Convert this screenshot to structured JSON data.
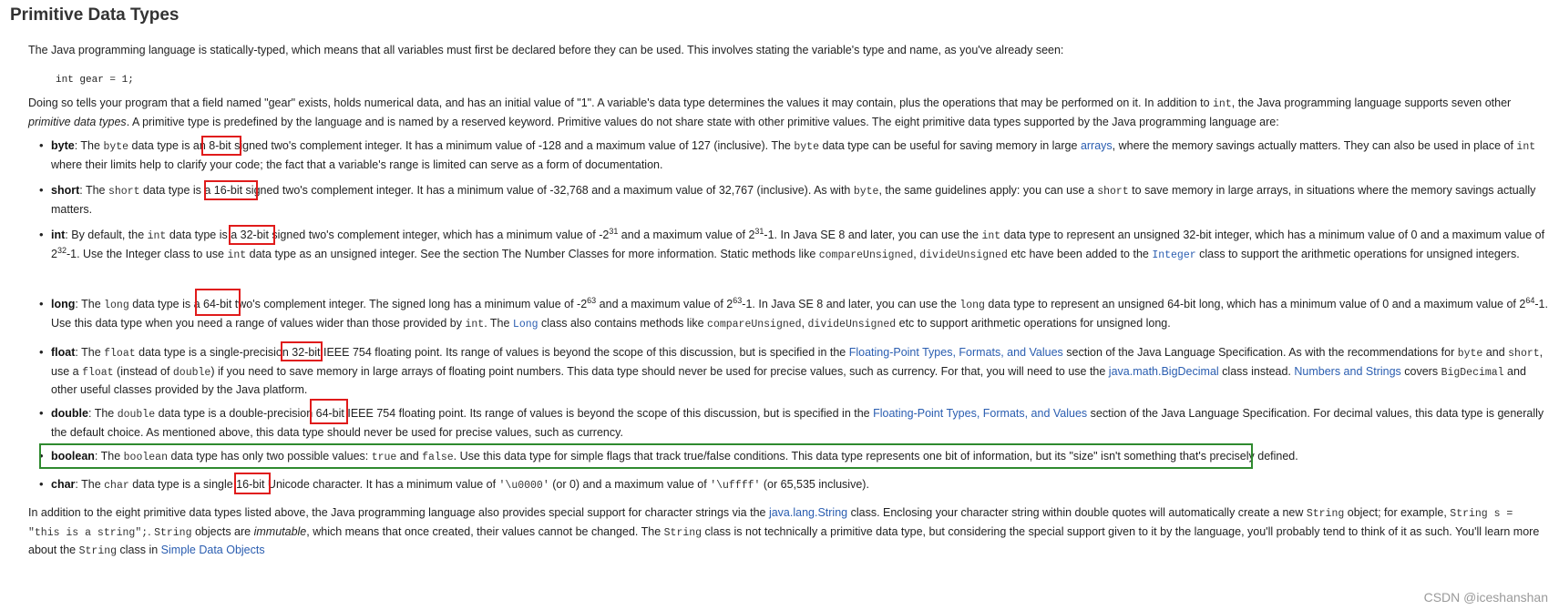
{
  "title": "Primitive Data Types",
  "intro": {
    "p1": "The Java programming language is statically-typed, which means that all variables must first be declared before they can be used. This involves stating the variable's type and name, as you've already seen:",
    "code": "int gear = 1;",
    "p2a": "Doing so tells your program that a field named \"gear\" exists, holds numerical data, and has an initial value of \"1\". A variable's data type determines the values it may contain, plus the operations that may be performed on it. In addition to ",
    "p2_int": "int",
    "p2b": ", the Java programming language supports seven other ",
    "p2_em": "primitive data types",
    "p2c": ". A primitive type is predefined by the language and is named by a reserved keyword. Primitive values do not share state with other primitive values. The eight primitive data types supported by the Java programming language are:"
  },
  "items": {
    "byte": {
      "term": "byte",
      "t1": ": The ",
      "c1": "byte",
      "t2": " data type is an 8-bit signed two's complement integer. It has a minimum value of -128 and a maximum value of 127 (inclusive). The ",
      "c2": "byte",
      "t3": " data type can be useful for saving memory in large ",
      "link1": "arrays",
      "t4": ", where the memory savings actually matters. They can also be used in place of ",
      "c3": "int",
      "t5": " where their limits help to clarify your code; the fact that a variable's range is limited can serve as a form of documentation."
    },
    "short": {
      "term": "short",
      "t1": ": The ",
      "c1": "short",
      "t2": " data type is a 16-bit signed two's complement integer. It has a minimum value of -32,768 and a maximum value of 32,767 (inclusive). As with ",
      "c2": "byte",
      "t3": ", the same guidelines apply: you can use a ",
      "c3": "short",
      "t4": " to save memory in large arrays, in situations where the memory savings actually matters."
    },
    "int": {
      "term": "int",
      "t1": ": By default, the ",
      "c1": "int",
      "t2": " data type is a 32-bit signed two's complement integer, which has a minimum value of -2",
      "s1": "31",
      "t3": " and a maximum value of 2",
      "s2": "31",
      "t4": "-1. In Java SE 8 and later, you can use the ",
      "c2": "int",
      "t5": " data type to represent an unsigned 32-bit integer, which has a minimum value of 0 and a maximum value of 2",
      "s3": "32",
      "t6": "-1. Use the Integer class to use ",
      "c3": "int",
      "t7": " data type as an unsigned integer. See the section The Number Classes for more information. Static methods like ",
      "c4": "compareUnsigned",
      "t8": ", ",
      "c5": "divideUnsigned",
      "t9": " etc have been added to the ",
      "link1": "Integer",
      "t10": " class to support the arithmetic operations for unsigned integers."
    },
    "long": {
      "term": "long",
      "t1": ": The ",
      "c1": "long",
      "t2": " data type is a 64-bit two's complement integer. The signed long has a minimum value of -2",
      "s1": "63",
      "t3": " and a maximum value of 2",
      "s2": "63",
      "t4": "-1. In Java SE 8 and later, you can use the ",
      "c2": "long",
      "t5": " data type to represent an unsigned 64-bit long, which has a minimum value of 0 and a maximum value of 2",
      "s3": "64",
      "t6": "-1. Use this data type when you need a range of values wider than those provided by ",
      "c3": "int",
      "t7": ". The ",
      "link1": "Long",
      "t8": " class also contains methods like ",
      "c4": "compareUnsigned",
      "t9": ", ",
      "c5": "divideUnsigned",
      "t10": " etc to support arithmetic operations for unsigned long."
    },
    "float": {
      "term": "float",
      "t1": ": The ",
      "c1": "float",
      "t2": " data type is a single-precision 32-bit IEEE 754 floating point. Its range of values is beyond the scope of this discussion, but is specified in the ",
      "link1": "Floating-Point Types, Formats, and Values",
      "t3": " section of the Java Language Specification. As with the recommendations for ",
      "c2": "byte",
      "t4": " and ",
      "c3": "short",
      "t5": ", use a ",
      "c4": "float",
      "t6": " (instead of ",
      "c5": "double",
      "t7": ") if you need to save memory in large arrays of floating point numbers. This data type should never be used for precise values, such as currency. For that, you will need to use the ",
      "link2": "java.math.BigDecimal",
      "t8": " class instead. ",
      "link3": "Numbers and Strings",
      "t9": " covers ",
      "c6": "BigDecimal",
      "t10": " and other useful classes provided by the Java platform."
    },
    "double": {
      "term": "double",
      "t1": ": The ",
      "c1": "double",
      "t2": " data type is a double-precision 64-bit IEEE 754 floating point. Its range of values is beyond the scope of this discussion, but is specified in the ",
      "link1": "Floating-Point Types, Formats, and Values",
      "t3": " section of the Java Language Specification. For decimal values, this data type is generally the default choice. As mentioned above, this data type should never be used for precise values, such as currency."
    },
    "boolean": {
      "term": "boolean",
      "t1": ": The ",
      "c1": "boolean",
      "t2": " data type has only two possible values: ",
      "c2": "true",
      "t3": " and ",
      "c3": "false",
      "t4": ". Use this data type for simple flags that track true/false conditions. This data type represents one bit of information, but its \"size\" isn't something that's precisely defined."
    },
    "char": {
      "term": "char",
      "t1": ": The ",
      "c1": "char",
      "t2": " data type is a single 16-bit Unicode character. It has a minimum value of ",
      "c2": "'\\u0000'",
      "t3": " (or 0) and a maximum value of ",
      "c3": "'\\uffff'",
      "t4": " (or 65,535 inclusive)."
    }
  },
  "outro": {
    "t1": "In addition to the eight primitive data types listed above, the Java programming language also provides special support for character strings via the ",
    "link1": "java.lang.String",
    "t2": " class. Enclosing your character string within double quotes will automatically create a new ",
    "c1": "String",
    "t3": " object; for example, ",
    "c2": "String s = \"this is a string\";",
    "t4": ". ",
    "c3": "String",
    "t5": " objects are ",
    "em1": "immutable",
    "t6": ", which means that once created, their values cannot be changed. The ",
    "c4": "String",
    "t7": " class is not technically a primitive data type, but considering the special support given to it by the language, you'll probably tend to think of it as such. You'll learn more about the ",
    "c5": "String",
    "t8": " class in ",
    "link2": "Simple Data Objects"
  },
  "watermark": "CSDN @iceshanshan",
  "colors": {
    "link": "#2a5db0",
    "highlight_red": "#e01b1b",
    "highlight_green": "#2f8a2f"
  }
}
